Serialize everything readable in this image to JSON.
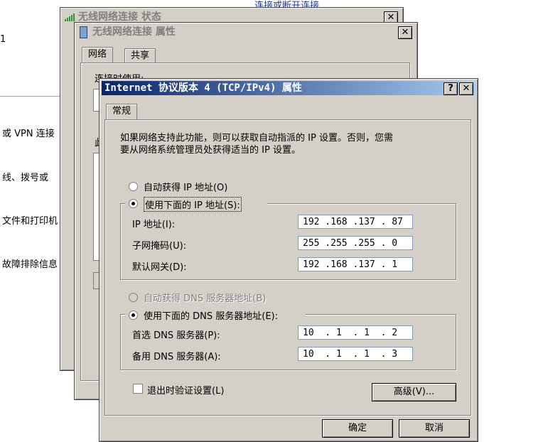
{
  "background": {
    "link_partial": "连接或断开连接",
    "left_partial_1": "或 VPN 连接",
    "left_partial_2": "线、拨号或",
    "left_partial_3": "文件和打印机",
    "left_partial_4": "故障排除信息",
    "left_char": "1"
  },
  "status_window": {
    "title": "无线网络连接 状态",
    "close": "✕"
  },
  "props_window": {
    "title": "无线网络连接 属性",
    "close": "✕",
    "tabs": [
      "网络",
      "共享"
    ],
    "connect_label": "连接时使用:",
    "this_label": "此"
  },
  "tcp_dialog": {
    "title": "Internet 协议版本 4 (TCP/IPv4) 属性",
    "help": "?",
    "close": "✕",
    "tab": "常规",
    "intro_line1": "如果网络支持此功能，则可以获取自动指派的 IP 设置。否则，您需",
    "intro_line2": "要从网络系统管理员处获得适当的 IP 设置。",
    "auto_ip": "自动获得 IP 地址(O)",
    "manual_ip": "使用下面的 IP 地址(S):",
    "ip_label": "IP 地址(I):",
    "mask_label": "子网掩码(U):",
    "gateway_label": "默认网关(D):",
    "ip_value": "192 .168 .137 . 87",
    "mask_value": "255 .255 .255 . 0",
    "gateway_value": "192 .168 .137 . 1",
    "auto_dns": "自动获得 DNS 服务器地址(B)",
    "manual_dns": "使用下面的 DNS 服务器地址(E):",
    "pref_dns_label": "首选 DNS 服务器(P):",
    "alt_dns_label": "备用 DNS 服务器(A):",
    "pref_dns_value": "10  . 1  . 1  . 2",
    "alt_dns_value": "10  . 1  . 1  . 3",
    "validate_label": "退出时验证设置(L)",
    "advanced_button": "高级(V)...",
    "ok_button": "确定",
    "cancel_button": "取消"
  }
}
